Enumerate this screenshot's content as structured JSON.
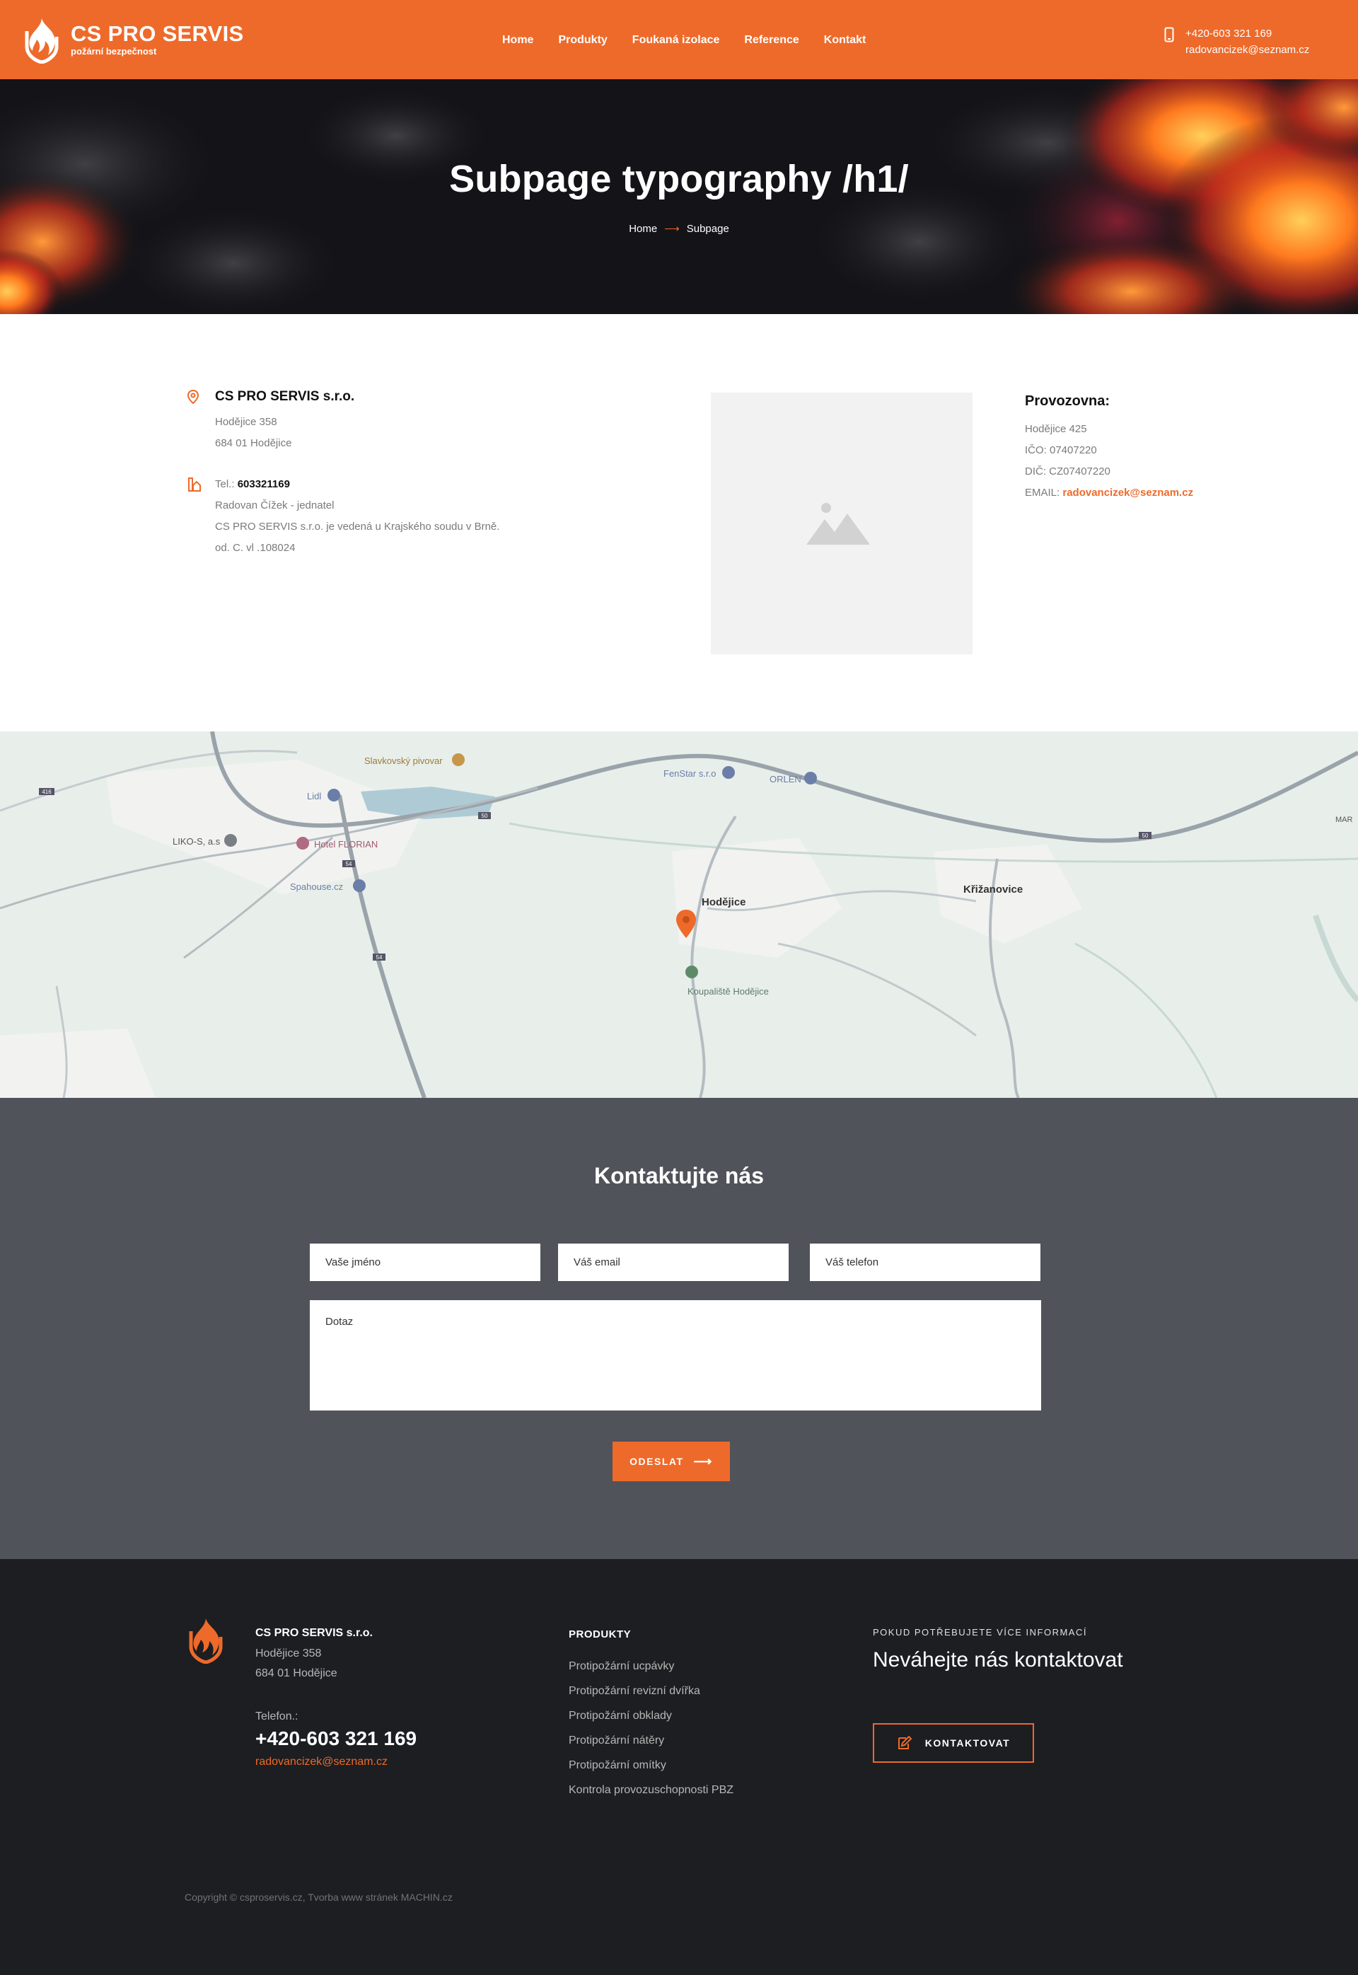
{
  "header": {
    "logo_title": "CS PRO SERVIS",
    "logo_subtitle": "požární bezpečnost",
    "nav": [
      {
        "label": "Home"
      },
      {
        "label": "Produkty"
      },
      {
        "label": "Foukaná izolace"
      },
      {
        "label": "Reference"
      },
      {
        "label": "Kontakt"
      }
    ],
    "phone": "+420-603 321 169",
    "email": "radovancizek@seznam.cz",
    "phone_icon": "mobile-phone-icon"
  },
  "hero": {
    "title": "Subpage typography /h1/",
    "breadcrumb_home": "Home",
    "breadcrumb_arrow": "⟶",
    "breadcrumb_current": "Subpage"
  },
  "info": {
    "company": "CS PRO SERVIS s.r.o.",
    "address_line1": "Hodějice 358",
    "address_line2": "684 01 Hodějice",
    "tel_label": "Tel.: ",
    "tel_value": "603321169",
    "person": "Radovan Čížek - jednatel",
    "registry_line1": "CS PRO SERVIS s.r.o. je vedená u Krajského soudu v Brně.",
    "registry_line2": "od. C. vl .108024",
    "branch_title": "Provozovna:",
    "branch_address": "Hodějice 425",
    "ico": "IČO: 07407220",
    "dic": "DIČ: CZ07407220",
    "email_label": "EMAIL: ",
    "email_value": "radovancizek@seznam.cz",
    "location_icon": "location-pin-icon",
    "phone_icon": "phone-house-icon",
    "image_icon": "image-placeholder-icon"
  },
  "map": {
    "labels": {
      "pivovar": "Slavkovský pivovar",
      "lidl": "Lidl",
      "hotel": "Hotel FLORIAN",
      "likos": "LIKO-S, a.s",
      "spahouse": "Spahouse.cz",
      "fenstar": "FenStar s.r.o",
      "orlen": "ORLEN",
      "hodejice": "Hodějice",
      "krizanovice": "Křižanovice",
      "koupaliste": "Koupaliště Hodějice",
      "mar": "MAR",
      "r416": "416",
      "r50a": "50",
      "r50b": "50",
      "r54a": "54",
      "r54b": "54"
    },
    "marker_icon": "map-marker-icon"
  },
  "form": {
    "title": "Kontaktujte nás",
    "name_placeholder": "Vaše jméno",
    "email_placeholder": "Váš email",
    "phone_placeholder": "Váš telefon",
    "message_placeholder": "Dotaz",
    "submit_label": "ODESLAT",
    "submit_arrow": "⟶"
  },
  "footer": {
    "company": "CS PRO SERVIS s.r.o.",
    "address_line1": "Hodějice 358",
    "address_line2": "684 01 Hodějice",
    "phone_label": "Telefon.:",
    "phone": "+420-603 321 169",
    "email": "radovancizek@seznam.cz",
    "products_title": "PRODUKTY",
    "products": [
      {
        "label": "Protipožární ucpávky"
      },
      {
        "label": "Protipožární revizní dvířka"
      },
      {
        "label": "Protipožární obklady"
      },
      {
        "label": "Protipožární nátěry"
      },
      {
        "label": "Protipožární omítky"
      },
      {
        "label": "Kontrola provozuschopnosti PBZ"
      }
    ],
    "more_info": "POKUD POTŘEBUJETE VÍCE INFORMACÍ",
    "cta_heading": "Neváhejte nás kontaktovat",
    "cta_button": "KONTAKTOVAT",
    "copyright": "Copyright © csproservis.cz, Tvorba www stránek MACHIN.cz"
  },
  "colors": {
    "accent": "#ee6a2a",
    "form_bg": "#50535a",
    "footer_bg": "#1c1e21",
    "map_bg": "#eaf0ec"
  }
}
